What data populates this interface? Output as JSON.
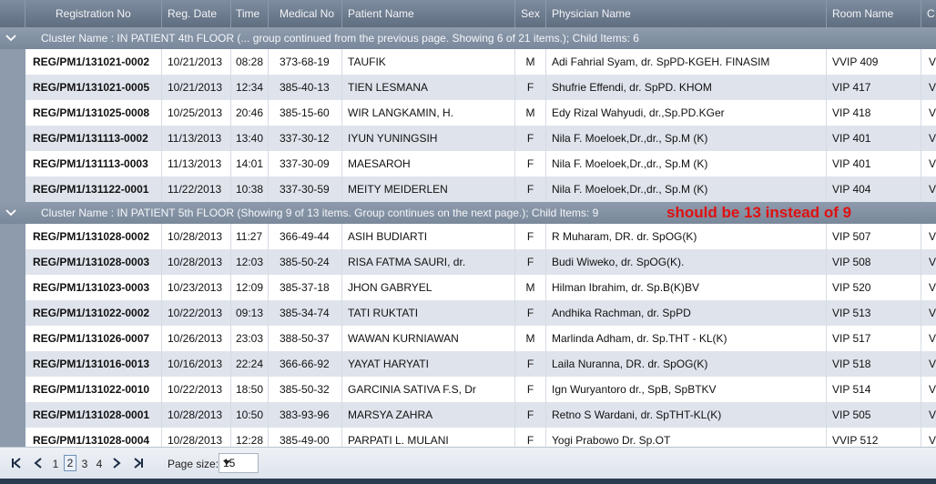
{
  "columns": [
    "Registration No",
    "Reg. Date",
    "Time",
    "Medical No",
    "Patient Name",
    "Sex",
    "Physician Name",
    "Room Name",
    "C"
  ],
  "groups": [
    {
      "label": "Cluster Name : IN PATIENT 4th FLOOR (... group continued from the previous page. Showing 6 of 21 items.); Child Items: 6",
      "rows": [
        [
          "REG/PM1/131021-0002",
          "10/21/2013",
          "08:28",
          "373-68-19",
          "TAUFIK",
          "M",
          "Adi Fahrial Syam, dr. SpPD-KGEH. FINASIM",
          "VVIP 409",
          "V"
        ],
        [
          "REG/PM1/131021-0005",
          "10/21/2013",
          "12:34",
          "385-40-13",
          "TIEN LESMANA",
          "F",
          "Shufrie Effendi, dr. SpPD. KHOM",
          "VIP 417",
          "V"
        ],
        [
          "REG/PM1/131025-0008",
          "10/25/2013",
          "20:46",
          "385-15-60",
          "WIR LANGKAMIN, H.",
          "M",
          "Edy Rizal Wahyudi, dr.,Sp.PD.KGer",
          "VIP 418",
          "V"
        ],
        [
          "REG/PM1/131113-0002",
          "11/13/2013",
          "13:40",
          "337-30-12",
          "IYUN YUNINGSIH",
          "F",
          "Nila F. Moeloek,Dr.,dr., Sp.M (K)",
          "VIP 401",
          "V"
        ],
        [
          "REG/PM1/131113-0003",
          "11/13/2013",
          "14:01",
          "337-30-09",
          "MAESAROH",
          "F",
          "Nila F. Moeloek,Dr.,dr., Sp.M (K)",
          "VIP 401",
          "V"
        ],
        [
          "REG/PM1/131122-0001",
          "11/22/2013",
          "10:38",
          "337-30-59",
          "MEITY MEIDERLEN",
          "F",
          "Nila F. Moeloek,Dr.,dr., Sp.M (K)",
          "VIP 404",
          "V"
        ]
      ]
    },
    {
      "label": "Cluster Name : IN PATIENT 5th FLOOR (Showing 9 of 13 items. Group continues on the next page.); Child Items: 9",
      "note": "should be 13 instead of 9",
      "rows": [
        [
          "REG/PM1/131028-0002",
          "10/28/2013",
          "11:27",
          "366-49-44",
          "ASIH BUDIARTI",
          "F",
          "R Muharam, DR. dr. SpOG(K)",
          "VIP 507",
          "V"
        ],
        [
          "REG/PM1/131028-0003",
          "10/28/2013",
          "12:03",
          "385-50-24",
          "RISA FATMA SAURI, dr.",
          "F",
          "Budi Wiweko, dr. SpOG(K).",
          "VIP 508",
          "V"
        ],
        [
          "REG/PM1/131023-0003",
          "10/23/2013",
          "12:09",
          "385-37-18",
          "JHON GABRYEL",
          "M",
          "Hilman Ibrahim, dr. Sp.B(K)BV",
          "VIP 520",
          "V"
        ],
        [
          "REG/PM1/131022-0002",
          "10/22/2013",
          "09:13",
          "385-34-74",
          "TATI RUKTATI",
          "F",
          "Andhika Rachman, dr. SpPD",
          "VIP 513",
          "V"
        ],
        [
          "REG/PM1/131026-0007",
          "10/26/2013",
          "23:03",
          "388-50-37",
          "WAWAN KURNIAWAN",
          "M",
          "Marlinda Adham, dr. Sp.THT - KL(K)",
          "VIP 517",
          "V"
        ],
        [
          "REG/PM1/131016-0013",
          "10/16/2013",
          "22:24",
          "366-66-92",
          "YAYAT HARYATI",
          "F",
          "Laila Nuranna, DR. dr. SpOG(K)",
          "VIP 518",
          "V"
        ],
        [
          "REG/PM1/131022-0010",
          "10/22/2013",
          "18:50",
          "385-50-32",
          "GARCINIA SATIVA F.S, Dr",
          "F",
          "Ign Wuryantoro dr., SpB, SpBTKV",
          "VIP 514",
          "V"
        ],
        [
          "REG/PM1/131028-0001",
          "10/28/2013",
          "10:50",
          "383-93-96",
          "MARSYA ZAHRA",
          "F",
          "Retno S Wardani, dr. SpTHT-KL(K)",
          "VIP 505",
          "V"
        ],
        [
          "REG/PM1/131028-0004",
          "10/28/2013",
          "12:28",
          "385-49-00",
          "PARPATI L. MULANI",
          "F",
          "Yogi Prabowo Dr. Sp.OT",
          "VVIP 512",
          "V"
        ]
      ]
    }
  ],
  "pager": {
    "pages": [
      "1",
      "2",
      "3",
      "4"
    ],
    "current": "2",
    "page_size_label": "Page size:",
    "page_size": "15",
    "icons": [
      "first-page-icon",
      "prev-page-icon",
      "next-page-icon",
      "last-page-icon"
    ]
  },
  "colors": {
    "header": "#6f7d90",
    "group": "#8391a4",
    "row_alt": "#dfe4ec",
    "note": "#e01010"
  }
}
